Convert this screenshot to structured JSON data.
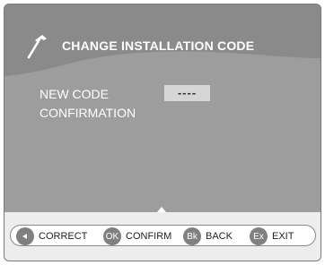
{
  "window": {
    "title": "CHANGE INSTALLATION CODE"
  },
  "icons": {
    "header": "hammer-icon",
    "correct": "left-arrow-icon"
  },
  "form": {
    "new_code_label": "NEW CODE",
    "confirmation_label": "CONFIRMATION",
    "new_code_value": "----"
  },
  "footer": {
    "hints": [
      {
        "key": "",
        "label": "CORRECT"
      },
      {
        "key": "OK",
        "label": "CONFIRM"
      },
      {
        "key": "Bk",
        "label": "BACK"
      },
      {
        "key": "Ex",
        "label": "EXIT"
      }
    ]
  },
  "colors": {
    "panel": "#9d9d9d",
    "header_wave": "#8a8a8a",
    "footer": "#ededed",
    "key_button": "#808080",
    "input_box": "#d6d6d6"
  }
}
